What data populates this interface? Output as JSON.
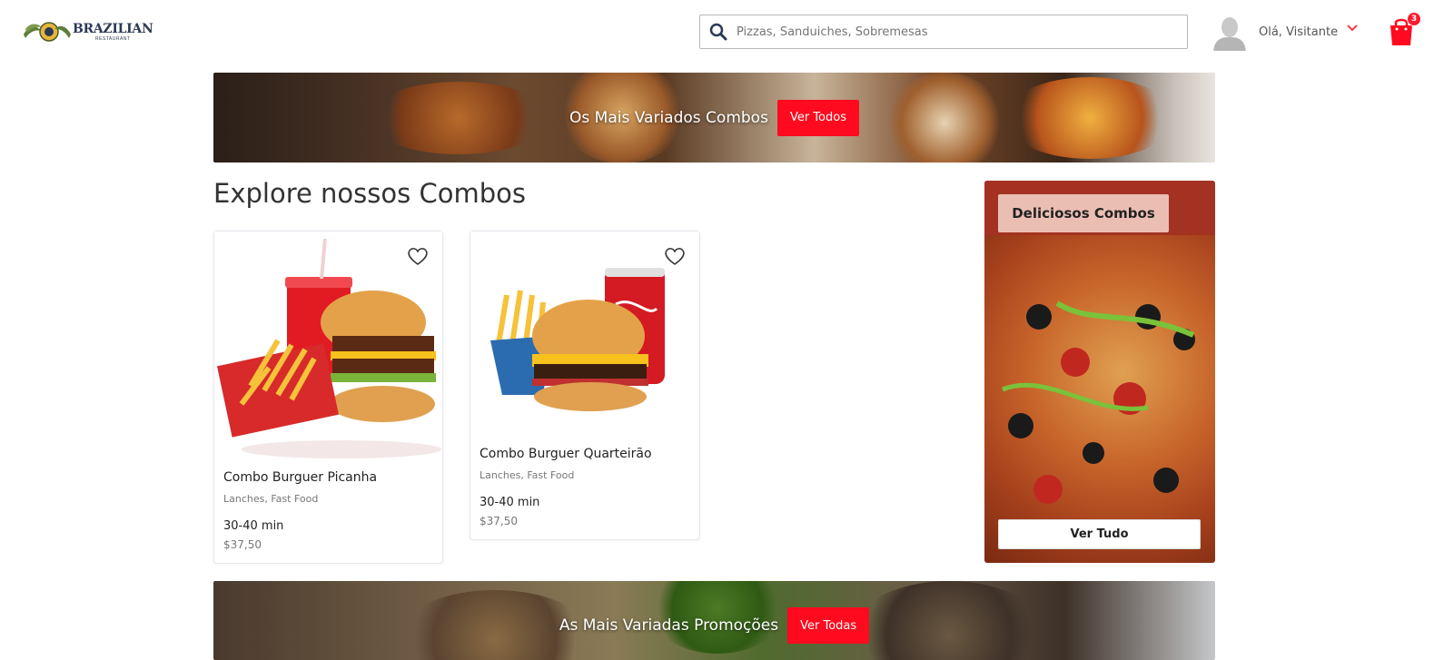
{
  "header": {
    "logo": {
      "title": "BRAZILIAN",
      "subtitle": "RESTAURANT"
    },
    "search": {
      "placeholder": "Pizzas, Sanduiches, Sobremesas",
      "icon": "search-icon"
    },
    "user": {
      "greeting": "Olá, Visitante"
    },
    "cart": {
      "count": "3"
    }
  },
  "banner_top": {
    "title": "Os Mais Variados Combos",
    "button": "Ver Todos"
  },
  "section": {
    "title": "Explore nossos Combos"
  },
  "products": [
    {
      "title": "Combo Burguer Picanha",
      "categories": "Lanches, Fast Food",
      "time": "30-40 min",
      "price": "$37,50"
    },
    {
      "title": "Combo Burguer Quarteirão",
      "categories": "Lanches, Fast Food",
      "time": "30-40 min",
      "price": "$37,50"
    }
  ],
  "promo": {
    "label": "Deliciosos Combos",
    "button": "Ver Tudo"
  },
  "banner_bottom": {
    "title": "As Mais Variadas Promoções",
    "button": "Ver Todas"
  },
  "colors": {
    "accent": "#ff0a1e",
    "text": "#212529",
    "muted": "#777777"
  }
}
